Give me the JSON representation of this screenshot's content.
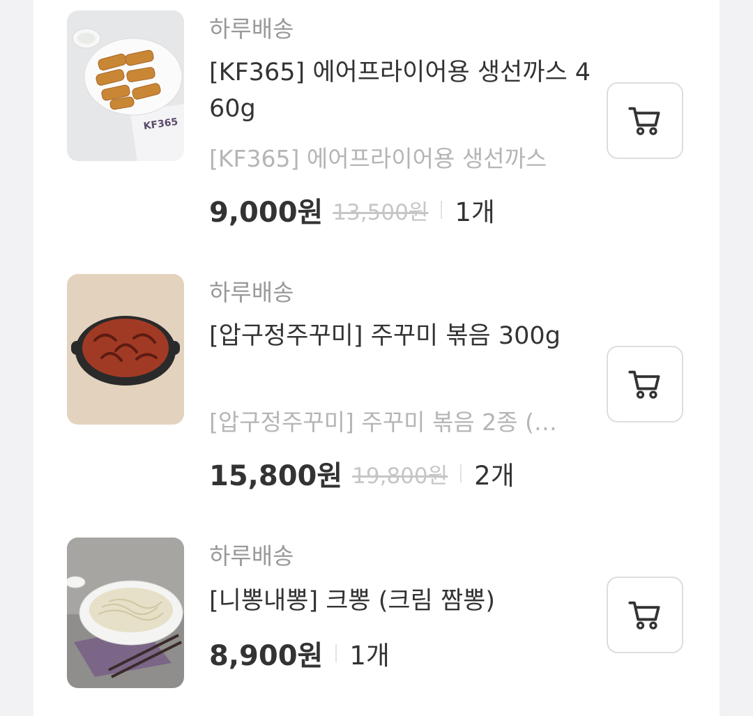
{
  "items": [
    {
      "delivery": "하루배송",
      "name": "[KF365] 에어프라이어용 생선까스 460g",
      "subname": "[KF365] 에어프라이어용 생선까스",
      "price": "9,000원",
      "original_price": "13,500원",
      "quantity": "1개",
      "thumbnail_icon": "fish-cutlet-photo",
      "cart_icon": "cart-icon"
    },
    {
      "delivery": "하루배송",
      "name": "[압구정주꾸미] 주꾸미 볶음 300g",
      "subname": "[압구정주꾸미] 주꾸미 볶음 2종 (…",
      "price": "15,800원",
      "original_price": "19,800원",
      "quantity": "2개",
      "thumbnail_icon": "stir-fried-octopus-photo",
      "cart_icon": "cart-icon"
    },
    {
      "delivery": "하루배송",
      "name": "[니뽕내뽕] 크뽕 (크림 짬뽕)",
      "price": "8,900원",
      "quantity": "1개",
      "thumbnail_icon": "cream-jjamppong-photo",
      "cart_icon": "cart-icon"
    }
  ]
}
